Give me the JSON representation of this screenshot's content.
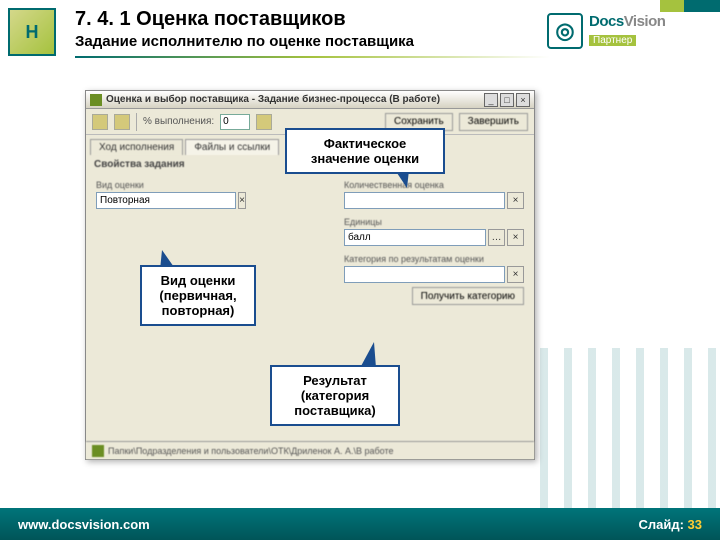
{
  "header": {
    "title": "7. 4. 1  Оценка поставщиков",
    "subtitle": "Задание исполнителю по оценке поставщика"
  },
  "partner": {
    "docs": "Docs",
    "vision": "Vision",
    "label": "Партнер"
  },
  "window": {
    "title": "Оценка и выбор поставщика - Задание бизнес-процесса (В работе)",
    "toolbar": {
      "pct_label": "% выполнения:",
      "pct_value": "0",
      "btn_save": "Сохранить",
      "btn_complete": "Завершить"
    },
    "tabs": {
      "t1": "Ход исполнения",
      "t2": "Файлы и ссылки"
    },
    "section": "Свойства задания",
    "fields": {
      "left_label": "Вид оценки",
      "left_value": "Повторная",
      "r1_label": "Количественная оценка",
      "r1_value": "",
      "r2_label": "Единицы",
      "r2_value": "балл",
      "r3_label": "Категория по результатам оценки",
      "r3_value": "",
      "r3_btn": "Получить категорию"
    },
    "status": "Папки\\Подразделения и пользователи\\ОТК\\Дриленок А. А.\\В работе"
  },
  "callouts": {
    "c1": "Фактическое значение оценки",
    "c2": "Вид оценки (первичная, повторная)",
    "c3": "Результат (категория поставщика)"
  },
  "footer": {
    "url": "www.docsvision.com",
    "slide_label": "Слайд: ",
    "slide_num": "33"
  }
}
